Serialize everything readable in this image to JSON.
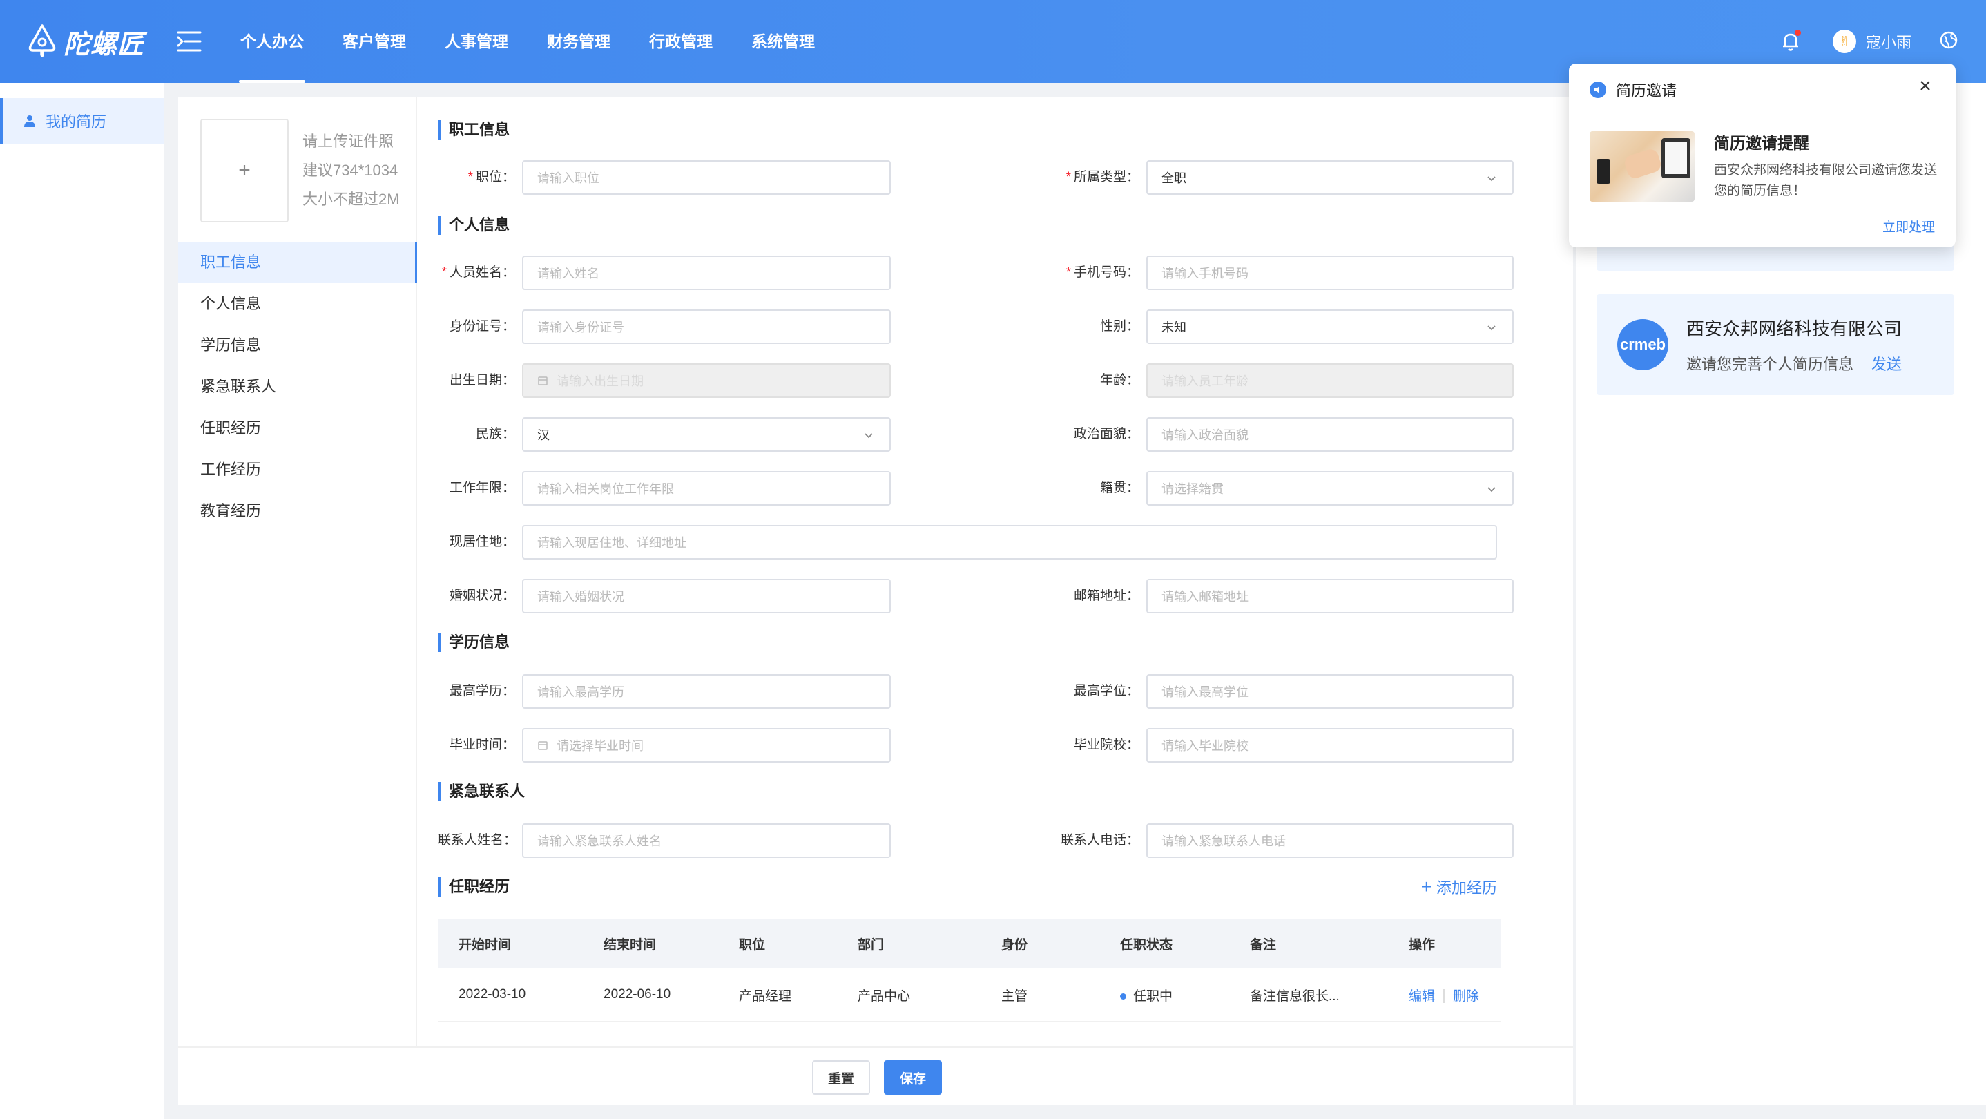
{
  "app": {
    "logo_text": "陀螺匠"
  },
  "nav": {
    "items": [
      {
        "label": "个人办公",
        "active": true
      },
      {
        "label": "客户管理"
      },
      {
        "label": "人事管理"
      },
      {
        "label": "财务管理"
      },
      {
        "label": "行政管理"
      },
      {
        "label": "系统管理"
      }
    ]
  },
  "user": {
    "name": "寇小雨"
  },
  "sidebar": {
    "item": "我的简历"
  },
  "photo": {
    "plus": "+",
    "hints": [
      "请上传证件照",
      "建议734*1034",
      "大小不超过2M"
    ]
  },
  "tabs": [
    "职工信息",
    "个人信息",
    "学历信息",
    "紧急联系人",
    "任职经历",
    "工作经历",
    "教育经历"
  ],
  "sections": {
    "job": "职工信息",
    "personal": "个人信息",
    "education": "学历信息",
    "emergency": "紧急联系人",
    "history": "任职经历"
  },
  "fields": {
    "position": {
      "label": "职位：",
      "placeholder": "请输入职位"
    },
    "type": {
      "label": "所属类型：",
      "value": "全职"
    },
    "name": {
      "label": "人员姓名：",
      "placeholder": "请输入姓名"
    },
    "phone": {
      "label": "手机号码：",
      "placeholder": "请输入手机号码"
    },
    "idcard": {
      "label": "身份证号：",
      "placeholder": "请输入身份证号"
    },
    "gender": {
      "label": "性别：",
      "value": "未知"
    },
    "birthday": {
      "label": "出生日期：",
      "placeholder": "请输入出生日期"
    },
    "age": {
      "label": "年龄：",
      "placeholder": "请输入员工年龄"
    },
    "ethnicity": {
      "label": "民族：",
      "value": "汉"
    },
    "politics": {
      "label": "政治面貌：",
      "placeholder": "请输入政治面貌"
    },
    "work_years": {
      "label": "工作年限：",
      "placeholder": "请输入相关岗位工作年限"
    },
    "native": {
      "label": "籍贯：",
      "placeholder": "请选择籍贯"
    },
    "address": {
      "label": "现居住地：",
      "placeholder": "请输入现居住地、详细地址"
    },
    "marital": {
      "label": "婚姻状况：",
      "placeholder": "请输入婚姻状况"
    },
    "email": {
      "label": "邮箱地址：",
      "placeholder": "请输入邮箱地址"
    },
    "degree": {
      "label": "最高学历：",
      "placeholder": "请输入最高学历"
    },
    "academic": {
      "label": "最高学位：",
      "placeholder": "请输入最高学位"
    },
    "grad_time": {
      "label": "毕业时间：",
      "placeholder": "请选择毕业时间"
    },
    "school": {
      "label": "毕业院校：",
      "placeholder": "请输入毕业院校"
    },
    "contact_name": {
      "label": "联系人姓名：",
      "placeholder": "请输入紧急联系人姓名"
    },
    "contact_phone": {
      "label": "联系人电话：",
      "placeholder": "请输入紧急联系人电话"
    }
  },
  "history": {
    "add_label": "添加经历",
    "columns": [
      "开始时间",
      "结束时间",
      "职位",
      "部门",
      "身份",
      "任职状态",
      "备注",
      "操作"
    ],
    "rows": [
      {
        "start": "2022-03-10",
        "end": "2022-06-10",
        "position": "产品经理",
        "dept": "产品中心",
        "role": "主管",
        "status": "任职中",
        "note": "备注信息很长...",
        "edit": "编辑",
        "delete": "删除"
      }
    ]
  },
  "footer": {
    "reset": "重置",
    "save": "保存"
  },
  "message": {
    "logo": "crmeb",
    "company": "西安众邦网络科技有限公司",
    "text": "邀请您完善个人简历信息",
    "action": "发送"
  },
  "popup": {
    "header": "简历邀请",
    "title": "简历邀请提醒",
    "desc": "西安众邦网络科技有限公司邀请您发送您的简历信息！",
    "action": "立即处理"
  },
  "colors": {
    "accent": "#3f86ee",
    "required": "#f5222d"
  }
}
